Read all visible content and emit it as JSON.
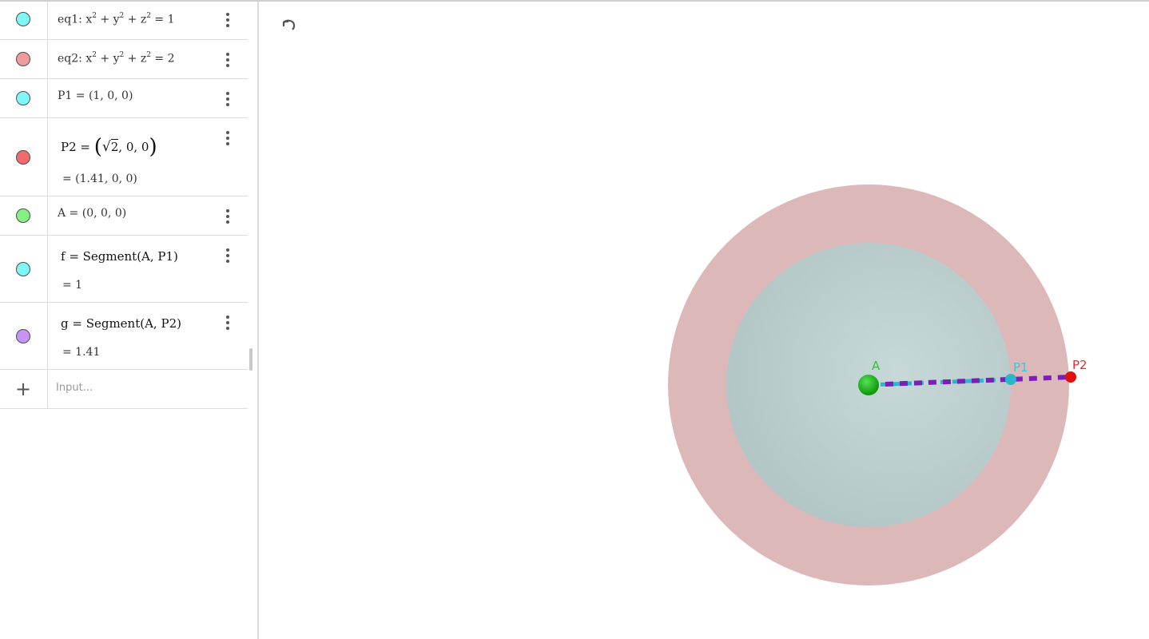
{
  "algebra": {
    "rows": [
      {
        "id": "eq1",
        "name": "eq1",
        "text_prefix": "eq1: x",
        "color": "#7ff7f7"
      },
      {
        "id": "eq2",
        "name": "eq2",
        "text_prefix": "eq2: x",
        "color": "#f09c9c"
      },
      {
        "id": "P1",
        "definition": "P1 = (1, 0, 0)",
        "color": "#7ff7f7"
      },
      {
        "id": "P2",
        "definition_prefix": "P2 = ",
        "sqrt_arg": "2",
        "definition_suffix": ", 0, 0",
        "value": "=  (1.41, 0, 0)",
        "color": "#f06b6b"
      },
      {
        "id": "A",
        "definition": "A = (0, 0, 0)",
        "color": "#86f086"
      },
      {
        "id": "f",
        "definition": "f  =  Segment(A, P1)",
        "value": "=  1",
        "color": "#7ff7f7"
      },
      {
        "id": "g",
        "definition": "g  =  Segment(A, P2)",
        "value": "=  1.41",
        "color": "#c993f5"
      }
    ],
    "eq1": {
      "left": "eq1: x",
      "mid1": " + y",
      "mid2": " + z",
      "right": " = 1",
      "exp": "2"
    },
    "eq2": {
      "left": "eq2: x",
      "mid1": " + y",
      "mid2": " + z",
      "right": " = 2",
      "exp": "2"
    },
    "input_placeholder": "Input..."
  },
  "graphics": {
    "labels": {
      "A": "A",
      "P1": "P1",
      "P2": "P2"
    },
    "colors": {
      "outer_sphere": "#ddb8b9",
      "inner_sphere": "#b8cbcb",
      "point_A": "#1fb81f",
      "point_P1": "#2ab8c8",
      "point_P2": "#e01010",
      "segment_g": "#7a1fb8",
      "segment_f": "#2ab8c8",
      "label_A": "#2ec82e",
      "label_P1": "#38c8d8",
      "label_P2": "#e03030"
    }
  },
  "icons": {
    "undo": "undo-icon",
    "menu": "more-vertical-icon",
    "add": "plus-icon"
  }
}
